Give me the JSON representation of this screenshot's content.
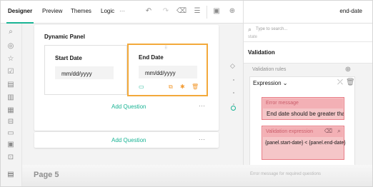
{
  "header": {
    "tabs": [
      {
        "label": "Designer"
      },
      {
        "label": "Preview"
      },
      {
        "label": "Themes"
      },
      {
        "label": "Logic"
      }
    ],
    "more_label": "⋯",
    "right_title": "end-date"
  },
  "toolbox": {
    "icons": [
      "search-icon",
      "radiogroup-icon",
      "rating-icon",
      "checkbox-icon",
      "dropdown-icon",
      "text-icon",
      "comment-icon",
      "panel-icon",
      "file-icon",
      "image-icon",
      "signature-icon",
      "expression-icon"
    ]
  },
  "panel_card": {
    "title": "Dynamic Panel",
    "start": {
      "label": "Start Date",
      "placeholder": "mm/dd/yyyy"
    },
    "end": {
      "label": "End Date",
      "placeholder": "mm/dd/yyyy"
    },
    "add_question": "Add Question",
    "more": "⋯"
  },
  "page_card": {
    "add_question": "Add Question",
    "more": "⋯"
  },
  "page_label": "Page 5",
  "properties": {
    "search_placeholder": "Type to search...",
    "clipped_text": "state",
    "validation_title": "Validation",
    "validation_rules_label": "Validation rules",
    "rule_type": "Expression",
    "error_message_label": "Error message",
    "error_message_value": "End date should be greater than star",
    "validation_expression_label": "Validation expression",
    "validation_expression_value": "{panel.start-date} < {panel.end-date}",
    "bottom_placeholder": "Error message for required questions"
  },
  "colors": {
    "accent": "#19b394",
    "selected_border": "#f3a93a",
    "action_orange": "#f39c34",
    "error": "#e97c86"
  }
}
